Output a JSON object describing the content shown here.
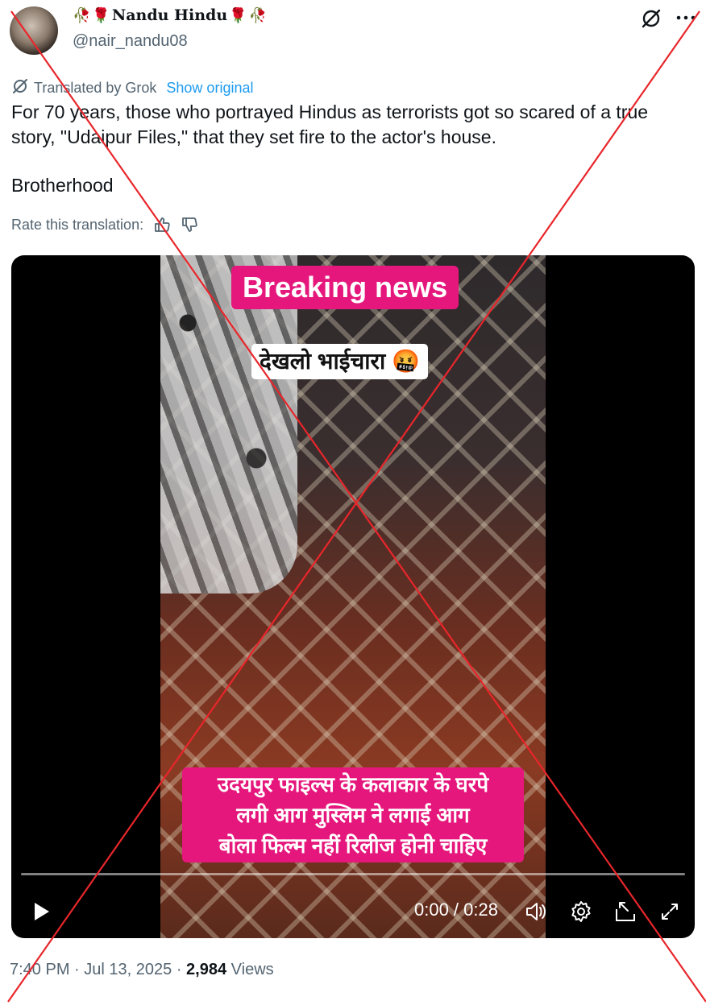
{
  "author": {
    "display_name": "Nandu Hindu",
    "name_prefix_emojis": [
      "🥀",
      "🌹"
    ],
    "name_suffix_emojis": [
      "🌹",
      "🥀"
    ],
    "handle": "@nair_nandu08"
  },
  "translation": {
    "label": "Translated by Grok",
    "show_original": "Show original",
    "rate_label": "Rate this translation:"
  },
  "tweet": {
    "lines": [
      "For 70 years, those who portrayed Hindus as terrorists got so scared of a true story, \"Udaipur Files,\" that they set fire to the actor's house.",
      "Brotherhood"
    ]
  },
  "video": {
    "banner_title": "Breaking news",
    "label": "देखलो भाईचारा 🤬",
    "subtitle_lines": [
      "उदयपुर फाइल्स के कलाकार के घरपे",
      "लगी आग मुस्लिम ने लगाई आग",
      "बोला फिल्म नहीं रिलीज होनी चाहिए"
    ],
    "time": "0:00 / 0:28",
    "progress": 0
  },
  "meta": {
    "time": "7:40 PM",
    "date": "Jul 13, 2025",
    "views_count": "2,984",
    "views_label": "Views"
  },
  "colors": {
    "link": "#1d9bf0",
    "banner_pink": "#e5177c",
    "cross": "#e8262b"
  }
}
